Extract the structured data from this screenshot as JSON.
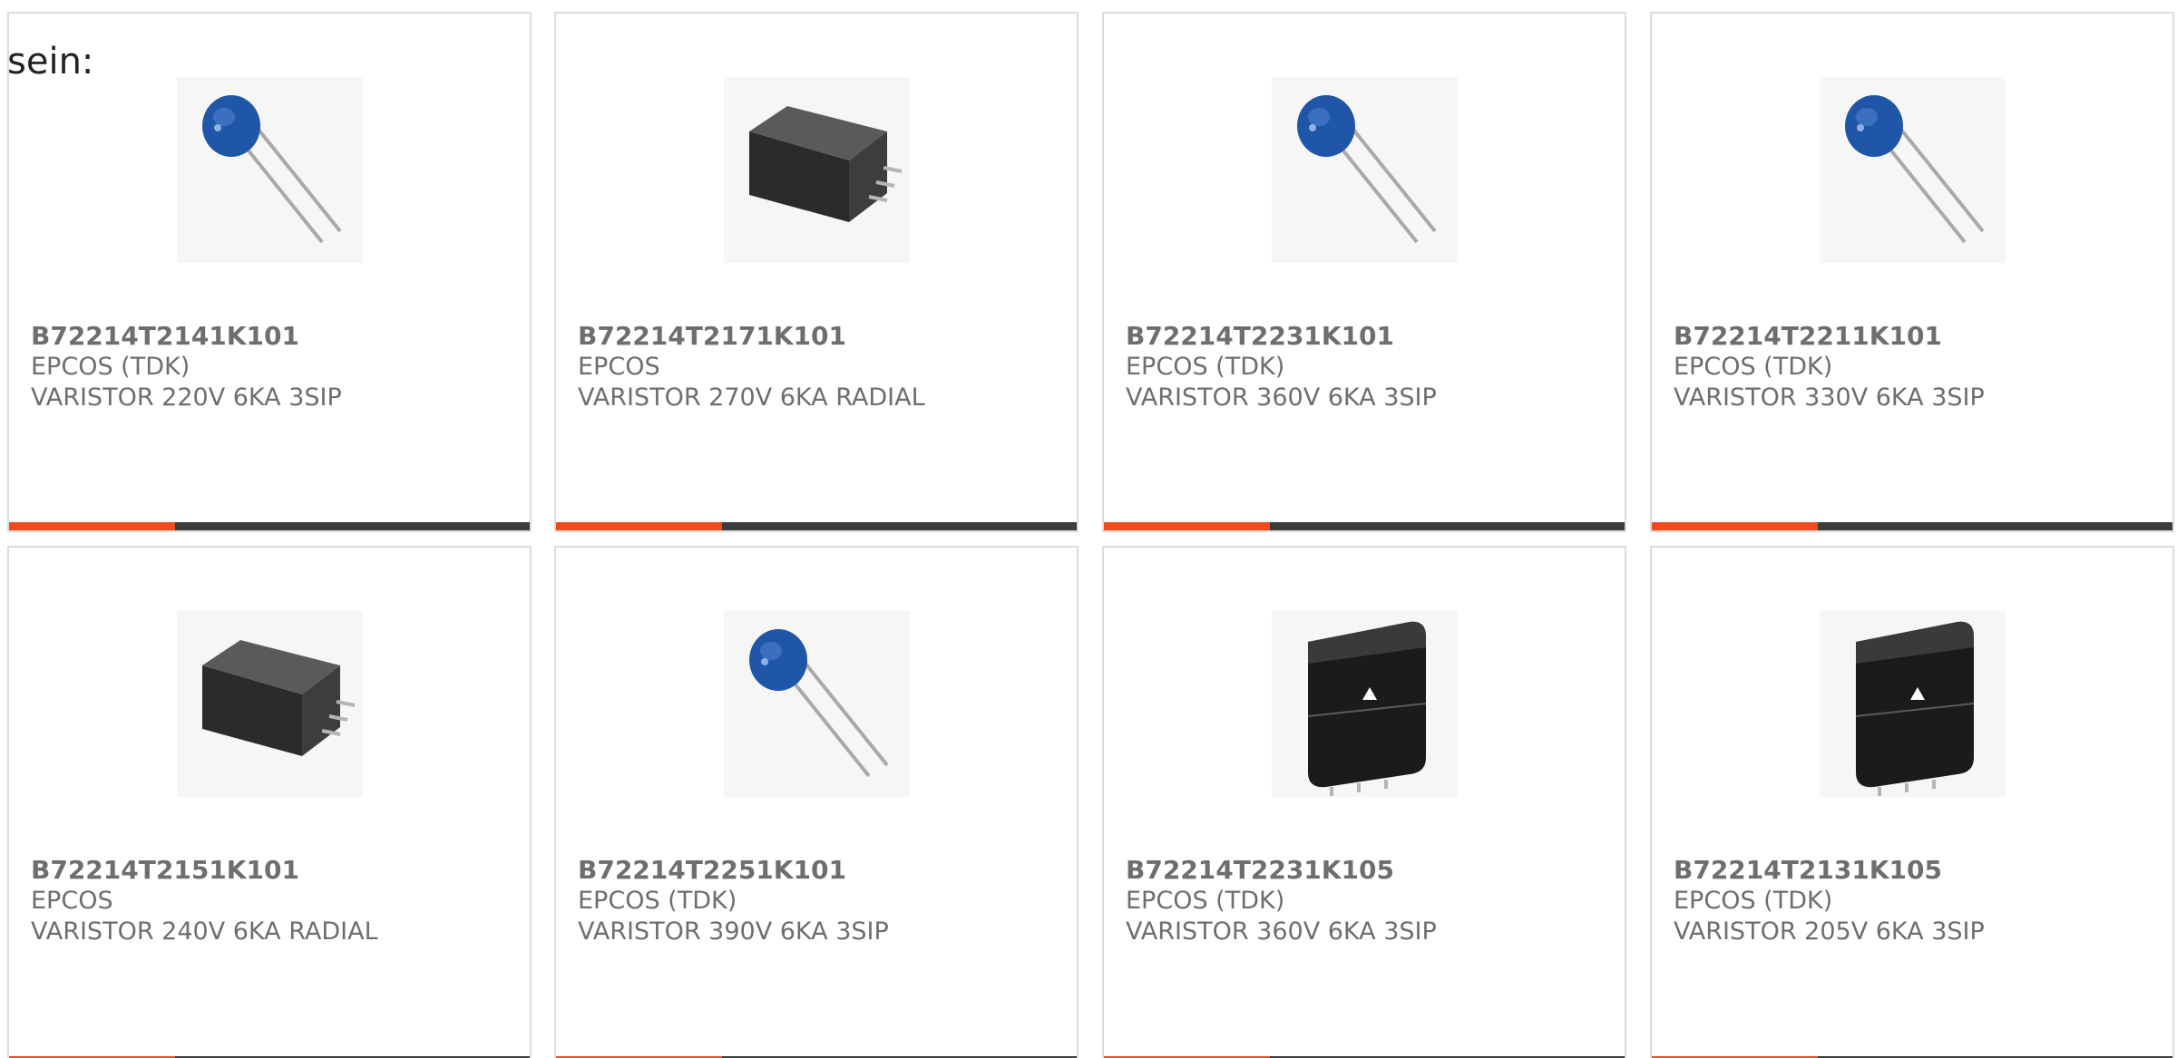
{
  "intro": {
    "text": "sein:"
  },
  "colors": {
    "accent": "#ef4c1b",
    "bar": "#3c3c3c",
    "text": "#6e6e6e",
    "border": "#dcdcdc",
    "disc_varistor": "#1f56a8"
  },
  "products": [
    {
      "part": "B72214T2141K101",
      "manufacturer": "EPCOS (TDK)",
      "description": "VARISTOR 220V 6KA 3SIP",
      "image": "disc-varistor-icon"
    },
    {
      "part": "B72214T2171K101",
      "manufacturer": "EPCOS",
      "description": "VARISTOR 270V 6KA RADIAL",
      "image": "block-varistor-icon"
    },
    {
      "part": "B72214T2231K101",
      "manufacturer": "EPCOS (TDK)",
      "description": "VARISTOR 360V 6KA 3SIP",
      "image": "disc-varistor-icon"
    },
    {
      "part": "B72214T2211K101",
      "manufacturer": "EPCOS (TDK)",
      "description": "VARISTOR 330V 6KA 3SIP",
      "image": "disc-varistor-icon"
    },
    {
      "part": "B72214T2151K101",
      "manufacturer": "EPCOS",
      "description": "VARISTOR 240V 6KA RADIAL",
      "image": "block-varistor-icon"
    },
    {
      "part": "B72214T2251K101",
      "manufacturer": "EPCOS (TDK)",
      "description": "VARISTOR 390V 6KA 3SIP",
      "image": "disc-varistor-icon"
    },
    {
      "part": "B72214T2231K105",
      "manufacturer": "EPCOS (TDK)",
      "description": "VARISTOR 360V 6KA 3SIP",
      "image": "encapsulated-varistor-icon"
    },
    {
      "part": "B72214T2131K105",
      "manufacturer": "EPCOS (TDK)",
      "description": "VARISTOR 205V 6KA 3SIP",
      "image": "encapsulated-varistor-icon"
    }
  ]
}
